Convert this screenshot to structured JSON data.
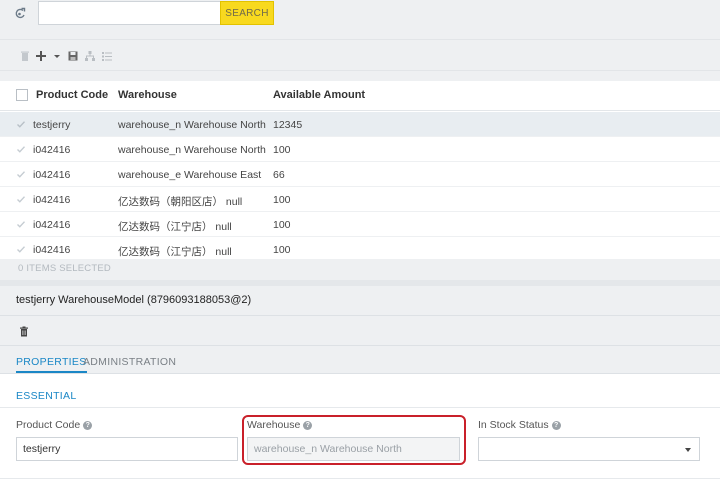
{
  "search": {
    "value": "",
    "placeholder": "",
    "button_label": "SEARCH"
  },
  "toolbar": {
    "icons": [
      "delete-icon",
      "add-icon",
      "dropdown-icon",
      "save-icon",
      "network-icon",
      "list-icon"
    ]
  },
  "table": {
    "columns": [
      "Product Code",
      "Warehouse",
      "Available Amount"
    ],
    "rows": [
      {
        "code": "testjerry",
        "warehouse": "warehouse_n Warehouse North",
        "amount": "12345",
        "selected": true
      },
      {
        "code": "i042416",
        "warehouse": "warehouse_n Warehouse North",
        "amount": "100",
        "selected": false
      },
      {
        "code": "i042416",
        "warehouse": "warehouse_e Warehouse East",
        "amount": "66",
        "selected": false
      },
      {
        "code": "i042416",
        "warehouse": "亿达数码（朝阳区店） null",
        "amount": "100",
        "selected": false
      },
      {
        "code": "i042416",
        "warehouse": "亿达数码（江宁店） null",
        "amount": "100",
        "selected": false
      },
      {
        "code": "i042416",
        "warehouse": "亿达数码（江宁店） null",
        "amount": "100",
        "selected": false
      }
    ],
    "selection_status": "0 ITEMS SELECTED"
  },
  "detail": {
    "title": "testjerry WarehouseModel (8796093188053@2)",
    "tabs": [
      "PROPERTIES",
      "ADMINISTRATION"
    ],
    "section": "ESSENTIAL",
    "fields": {
      "product_code": {
        "label": "Product Code",
        "value": "testjerry"
      },
      "warehouse": {
        "label": "Warehouse",
        "value": "warehouse_n Warehouse North"
      },
      "in_stock_status": {
        "label": "In Stock Status",
        "value": ""
      }
    }
  },
  "colors": {
    "accent": "#1a87c6",
    "search_button": "#f8d91f",
    "highlight": "#c9202a",
    "background": "#eef0f2"
  }
}
